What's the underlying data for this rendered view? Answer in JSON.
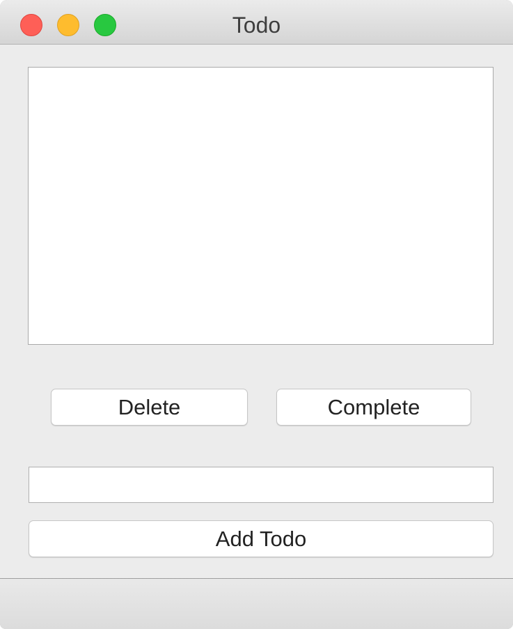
{
  "window": {
    "title": "Todo"
  },
  "titlebar": {
    "close_icon": "close-icon",
    "minimize_icon": "minimize-icon",
    "zoom_icon": "zoom-icon",
    "colors": {
      "close": "#fe5f57",
      "minimize": "#febc2e",
      "zoom": "#28c840"
    }
  },
  "todo_list": {
    "items": []
  },
  "actions": {
    "delete_label": "Delete",
    "complete_label": "Complete"
  },
  "new_todo": {
    "value": "",
    "placeholder": ""
  },
  "add_button": {
    "label": "Add Todo"
  }
}
